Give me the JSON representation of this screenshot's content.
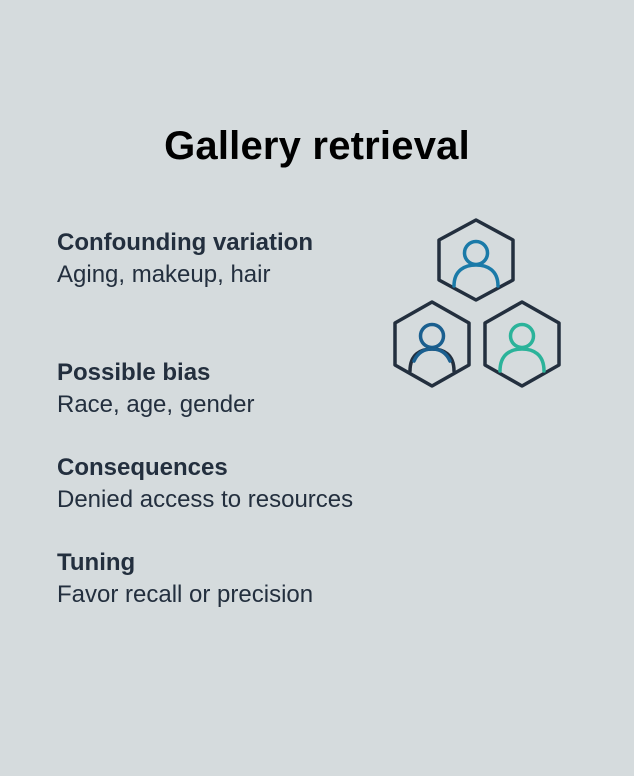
{
  "title": "Gallery retrieval",
  "sections": [
    {
      "heading": "Confounding variation",
      "desc": "Aging, makeup, hair"
    },
    {
      "heading": "Possible bias",
      "desc": "Race, age, gender"
    },
    {
      "heading": "Consequences",
      "desc": "Denied access to resources"
    },
    {
      "heading": "Tuning",
      "desc": "Favor recall or precision"
    }
  ],
  "icons": {
    "group": "people-hexagon-group-icon",
    "colors": {
      "hex_outline": "#232f3e",
      "top_person": "#1a7aa8",
      "left_person": "#1a5f8f",
      "right_person": "#2bb39a"
    }
  }
}
